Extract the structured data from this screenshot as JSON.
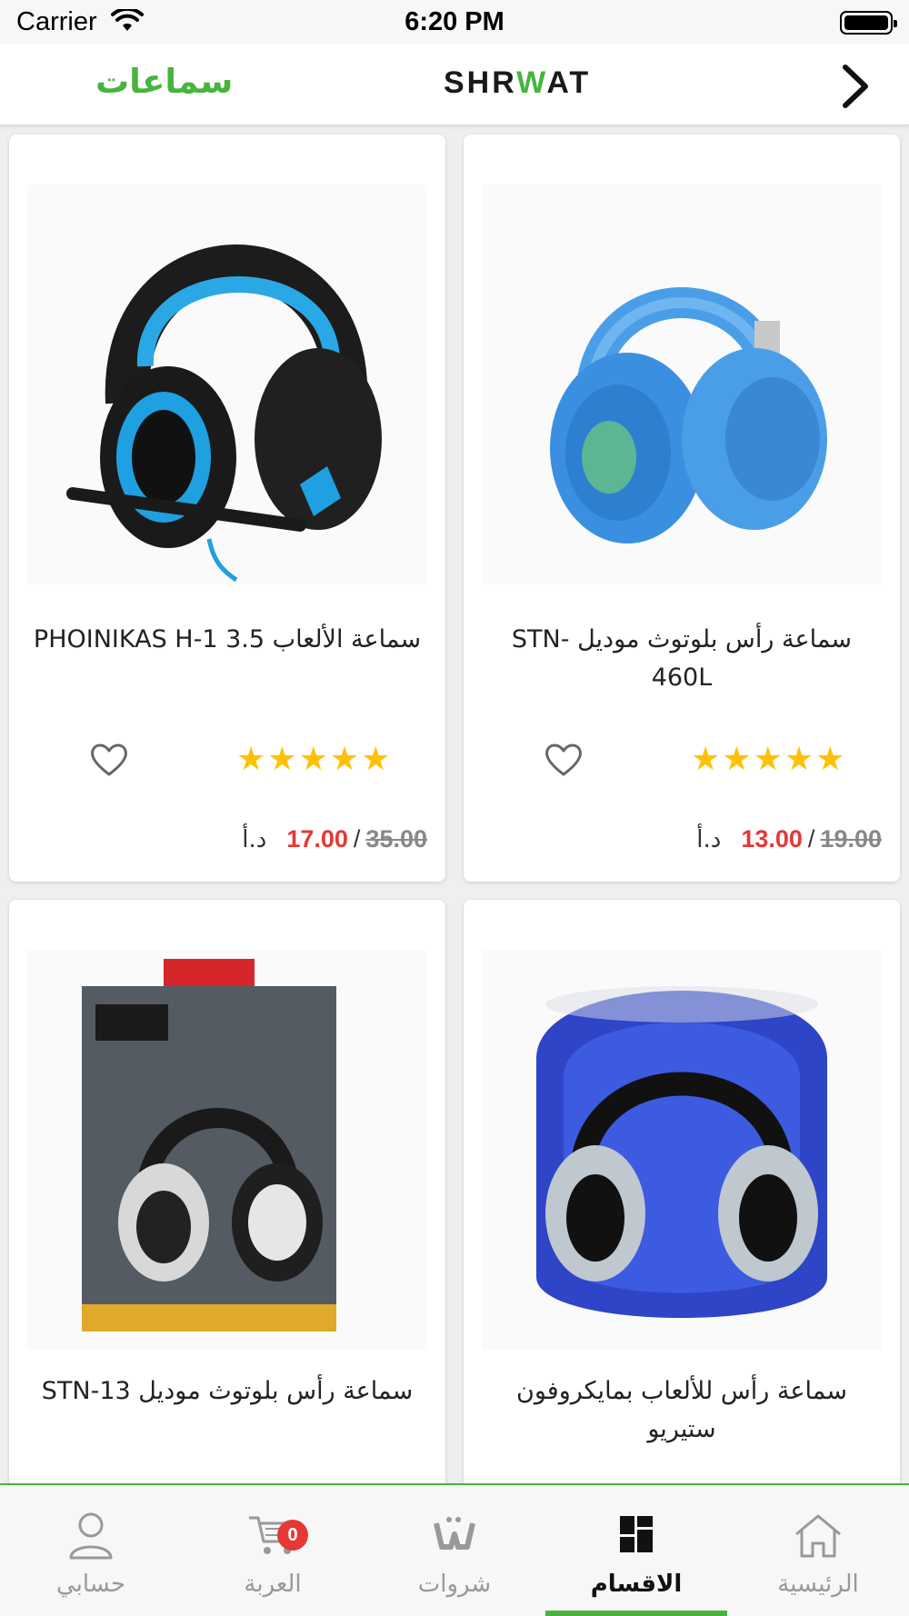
{
  "status_bar": {
    "carrier": "Carrier",
    "time": "6:20 PM"
  },
  "nav": {
    "title": "سماعات",
    "logo": "SHRWAT",
    "back_icon": "chevron-right-icon"
  },
  "products": [
    {
      "title": "سماعة رأس بلوتوث موديل STN-460L",
      "old_price": "19.00",
      "new_price": "13.00",
      "separator": "/",
      "currency": "د.أ",
      "rating": 5
    },
    {
      "title": "سماعة الألعاب PHOINIKAS H-1 3.5",
      "old_price": "35.00",
      "new_price": "17.00",
      "separator": "/",
      "currency": "د.أ",
      "rating": 5
    },
    {
      "title": "سماعة رأس للألعاب بمايكروفون ستيريو"
    },
    {
      "title": "سماعة رأس بلوتوث موديل STN-13"
    }
  ],
  "tabs": [
    {
      "label": "الرئيسية",
      "icon": "home-icon"
    },
    {
      "label": "الاقسام",
      "icon": "grid-icon"
    },
    {
      "label": "شروات",
      "icon": "shrwat-logo-icon"
    },
    {
      "label": "العربة",
      "icon": "cart-icon",
      "badge": "0"
    },
    {
      "label": "حسابي",
      "icon": "user-icon"
    }
  ],
  "active_tab": "الاقسام",
  "colors": {
    "accent": "#47b53d",
    "price": "#e53935",
    "star": "#ffc107"
  }
}
